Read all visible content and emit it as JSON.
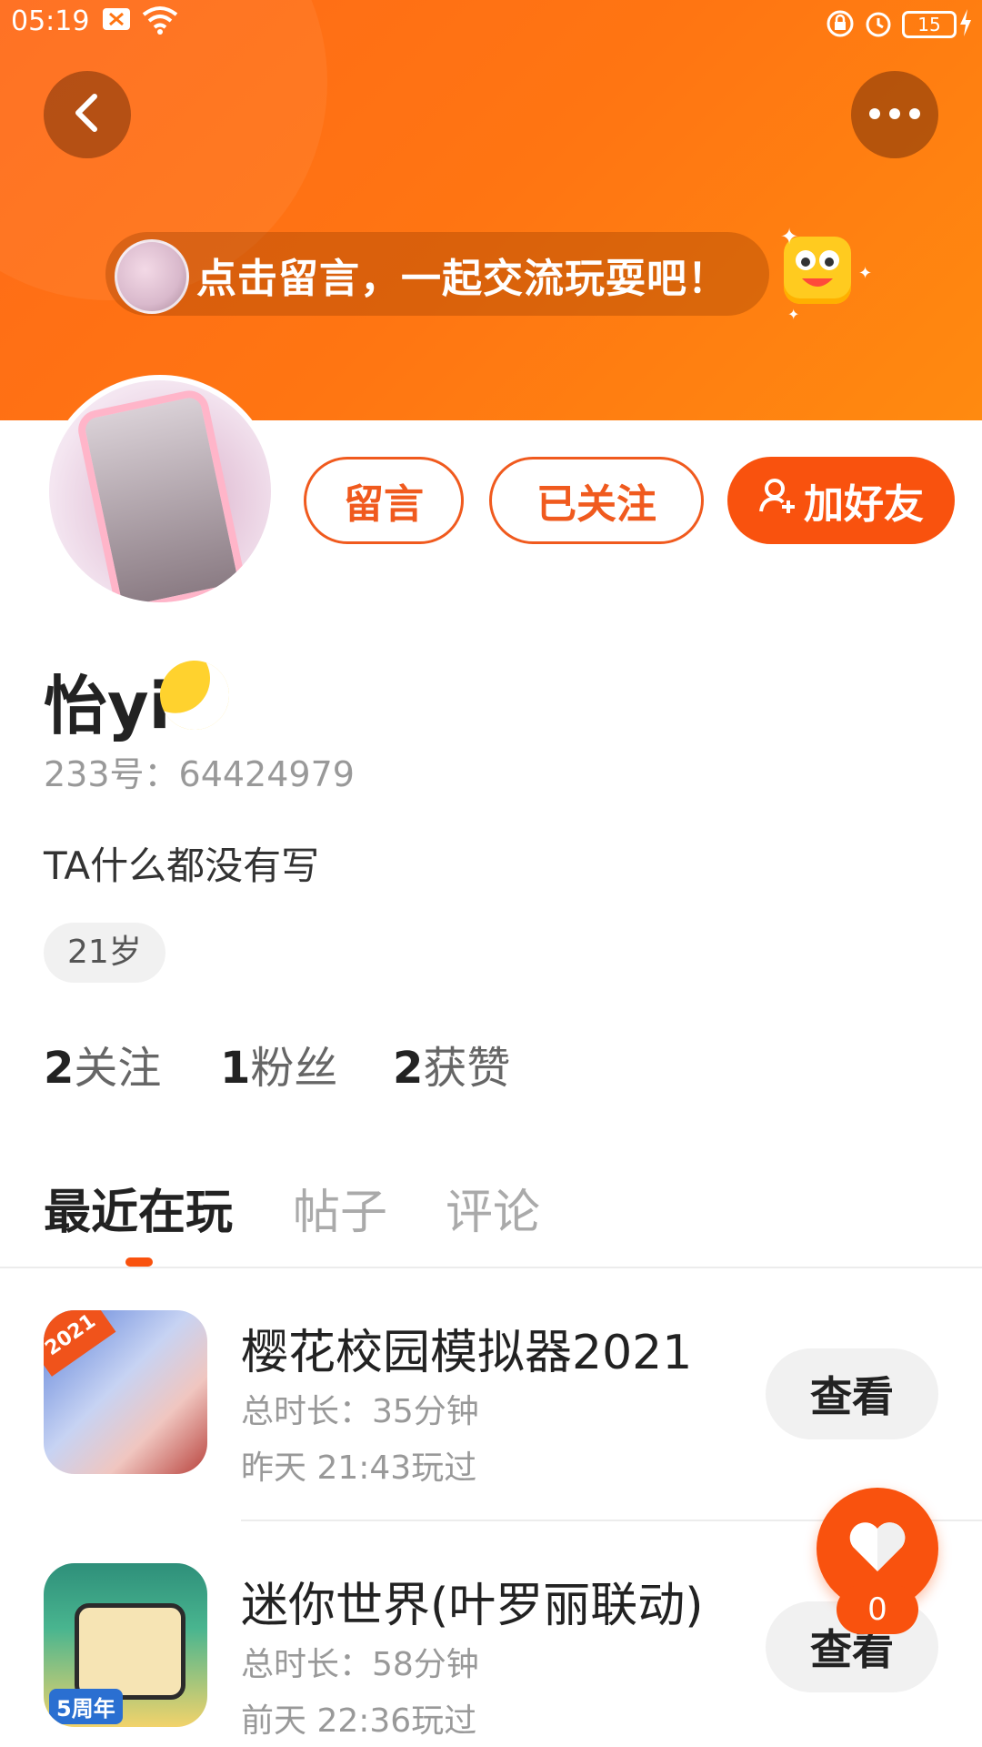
{
  "status_bar": {
    "time": "05:19",
    "battery": "15"
  },
  "header": {
    "back_icon": "chevron-left-icon",
    "more_icon": "more-horizontal-icon",
    "banner_text": "点击留言，一起交流玩耍吧！",
    "colors": {
      "start": "#ff6a18",
      "end": "#ff8a10"
    }
  },
  "actions": {
    "message_label": "留言",
    "following_label": "已关注",
    "add_friend_label": "加好友",
    "accent": "#f9520e"
  },
  "profile": {
    "name": "怡yi",
    "uid": "233号：64424979",
    "bio": "TA什么都没有写",
    "age_tag": "21岁",
    "stats": [
      {
        "value": "2",
        "label": "关注"
      },
      {
        "value": "1",
        "label": "粉丝"
      },
      {
        "value": "2",
        "label": "获赞"
      }
    ]
  },
  "tabs": [
    {
      "label": "最近在玩",
      "active": true
    },
    {
      "label": "帖子",
      "active": false
    },
    {
      "label": "评论",
      "active": false
    }
  ],
  "games": [
    {
      "title": "樱花校园模拟器2021",
      "duration": "总时长：35分钟",
      "last_played": "昨天 21:43玩过",
      "action": "查看",
      "badge": "2021"
    },
    {
      "title": "迷你世界(叶罗丽联动)",
      "duration": "总时长：58分钟",
      "last_played": "前天 22:36玩过",
      "action": "查看",
      "badge": "5周年"
    }
  ],
  "like": {
    "count": "0"
  }
}
